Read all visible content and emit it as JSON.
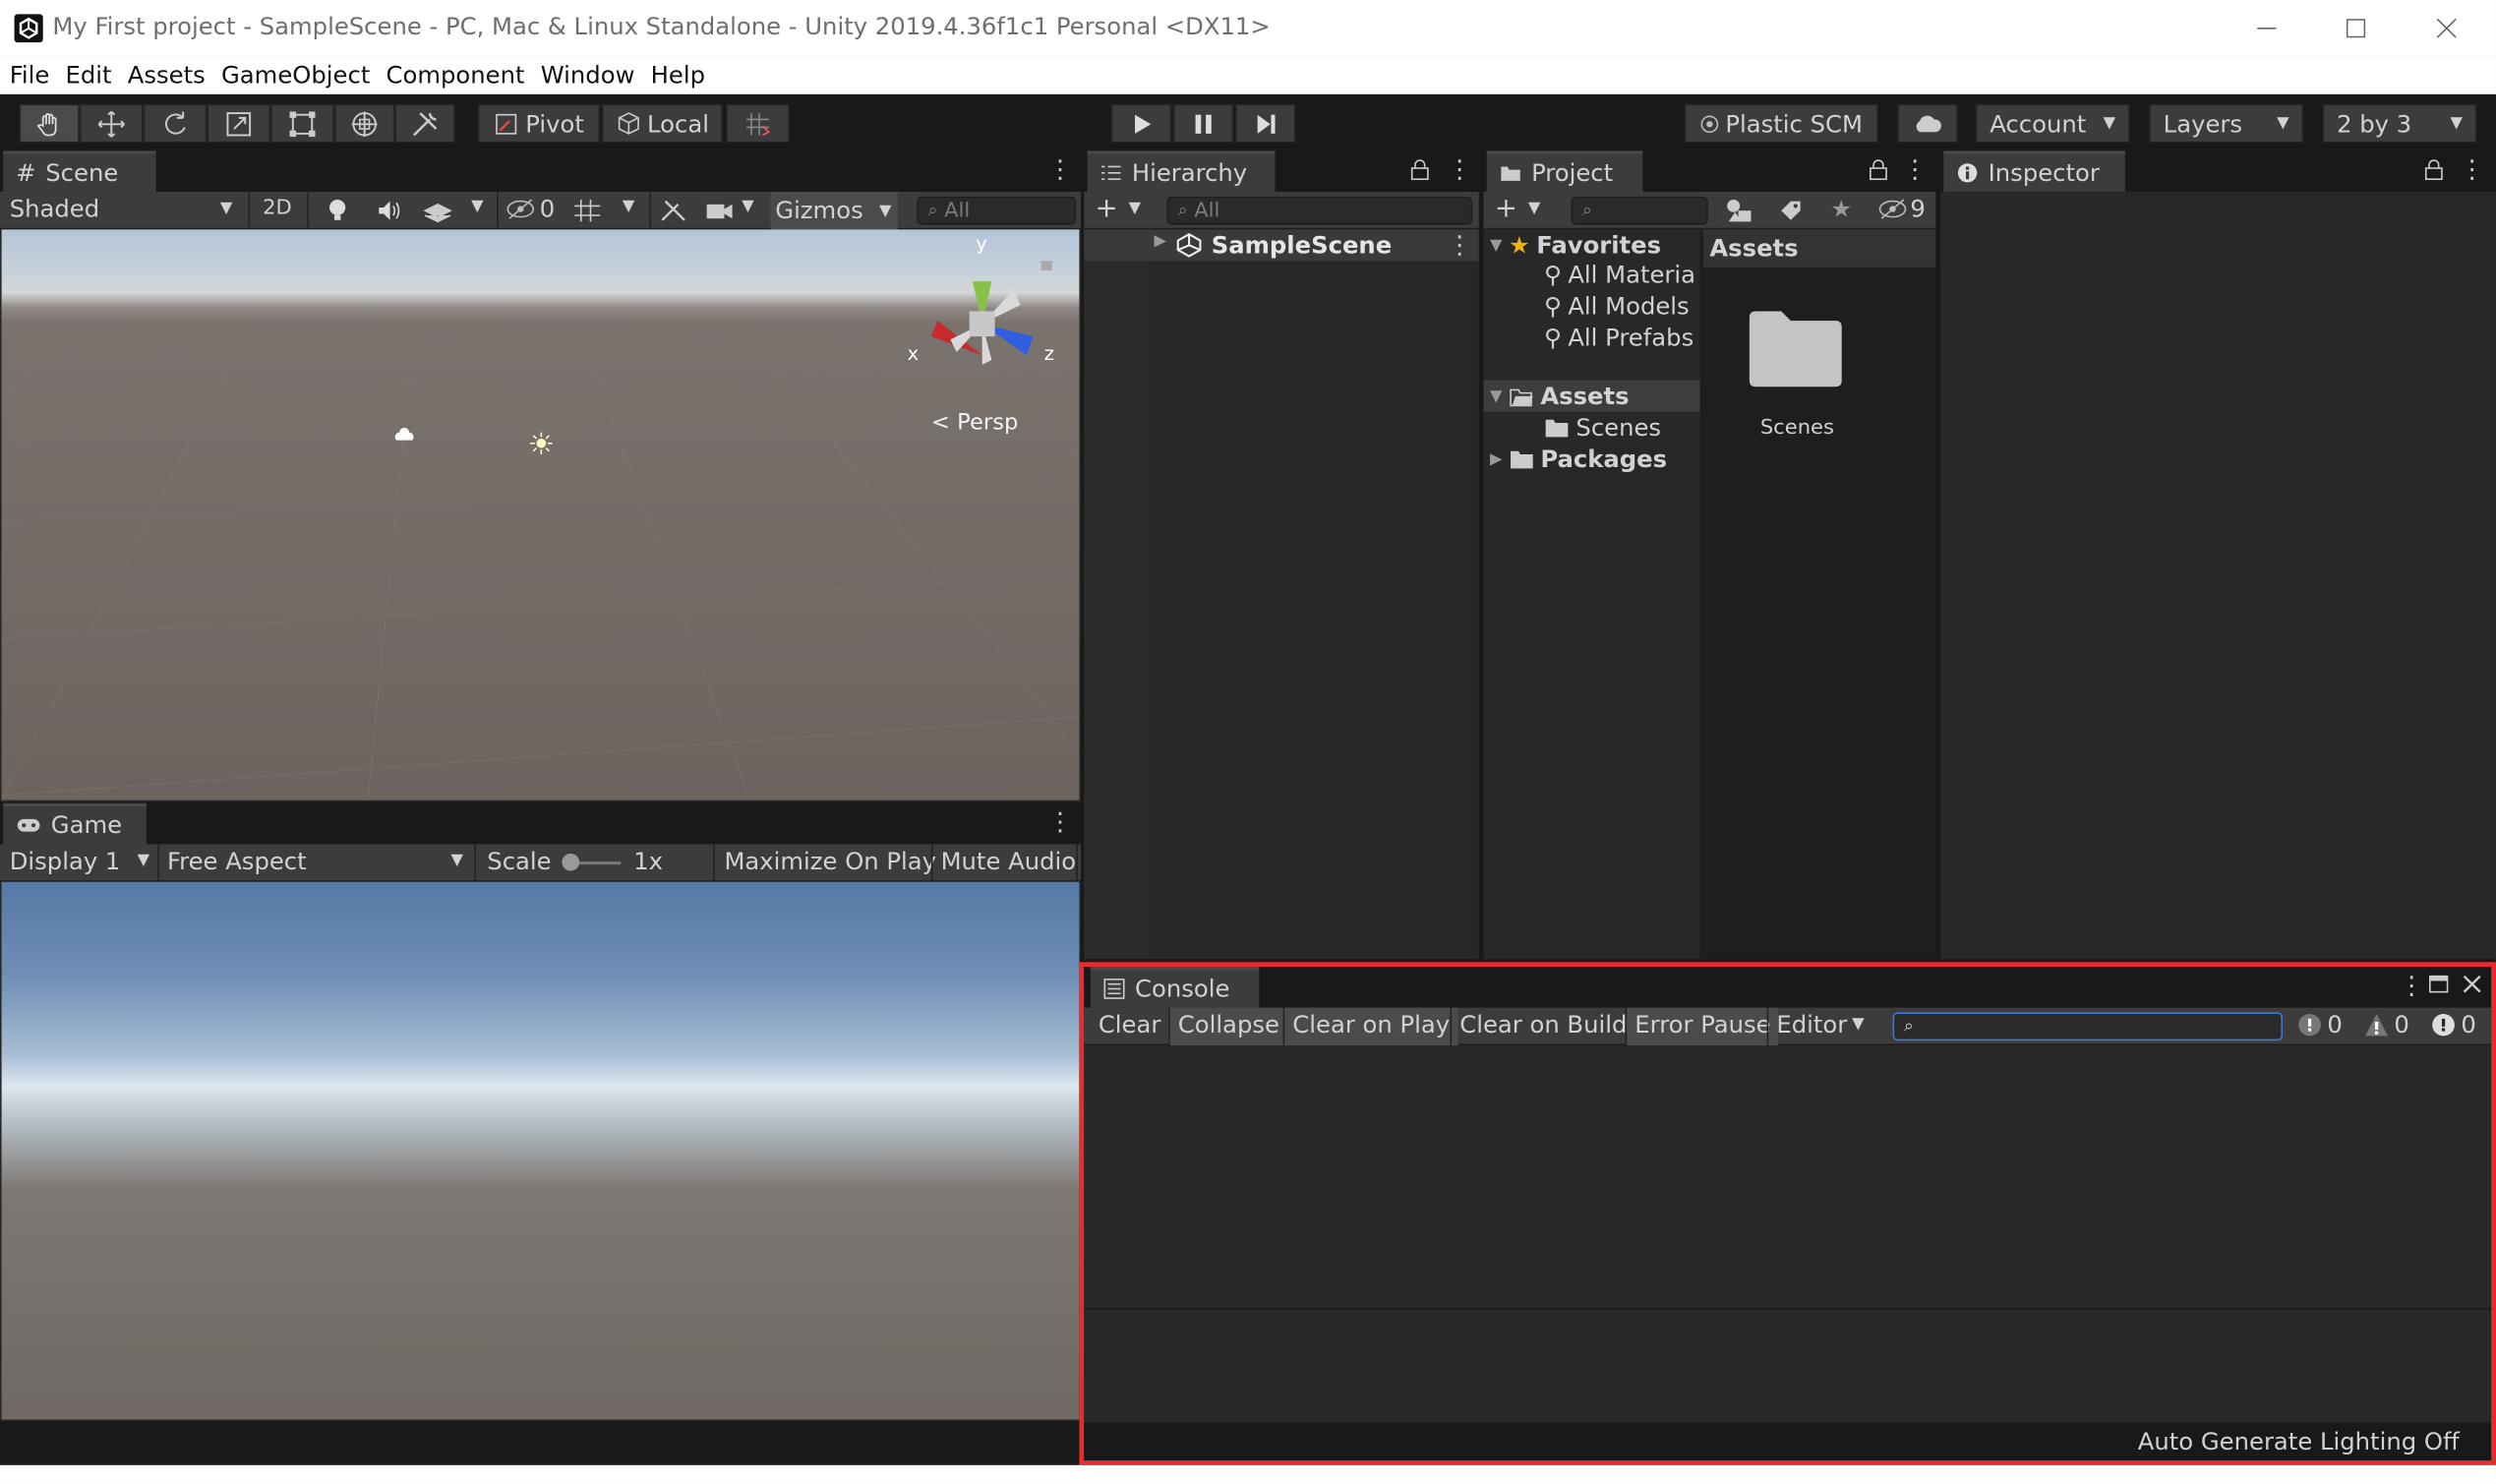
{
  "window": {
    "title": "My First project - SampleScene - PC, Mac & Linux Standalone - Unity 2019.4.36f1c1 Personal <DX11>",
    "controls": [
      "minimize-icon",
      "maximize-icon",
      "close-icon"
    ]
  },
  "menu": [
    "File",
    "Edit",
    "Assets",
    "GameObject",
    "Component",
    "Window",
    "Help"
  ],
  "toolbar": {
    "pivot": "Pivot",
    "local": "Local",
    "plastic": "Plastic SCM",
    "account": "Account",
    "layers": "Layers",
    "layout": "2 by 3"
  },
  "scene": {
    "tab": "Scene",
    "shading": "Shaded",
    "mode2d": "2D",
    "hidden_count": "0",
    "gizmos": "Gizmos",
    "search_placeholder": "All",
    "persp": "Persp",
    "axis_x": "x",
    "axis_y": "y",
    "axis_z": "z"
  },
  "game": {
    "tab": "Game",
    "display": "Display 1",
    "aspect": "Free Aspect",
    "scale_label": "Scale",
    "scale_value": "1x",
    "maximize": "Maximize On Play",
    "mute": "Mute Audio"
  },
  "hierarchy": {
    "tab": "Hierarchy",
    "search_placeholder": "All",
    "scene_item": "SampleScene"
  },
  "project": {
    "tab": "Project",
    "hidden_count": "9",
    "favorites": "Favorites",
    "fav_items": [
      "All Materia",
      "All Models",
      "All Prefabs"
    ],
    "assets": "Assets",
    "scenes": "Scenes",
    "packages": "Packages",
    "content_header": "Assets",
    "folder_label": "Scenes"
  },
  "inspector": {
    "tab": "Inspector"
  },
  "console": {
    "tab": "Console",
    "clear": "Clear",
    "collapse": "Collapse",
    "clear_on_play": "Clear on Play",
    "clear_on_build": "Clear on Build",
    "error_pause": "Error Pause",
    "editor": "Editor",
    "log_count": "0",
    "warn_count": "0",
    "error_count": "0"
  },
  "status": {
    "text": "Auto Generate Lighting Off"
  },
  "colors": {
    "highlight_border": "#e62c2c",
    "panel_bg": "#282828",
    "tab_bg": "#3c3c3c",
    "favorite_star": "#f0b30e"
  }
}
